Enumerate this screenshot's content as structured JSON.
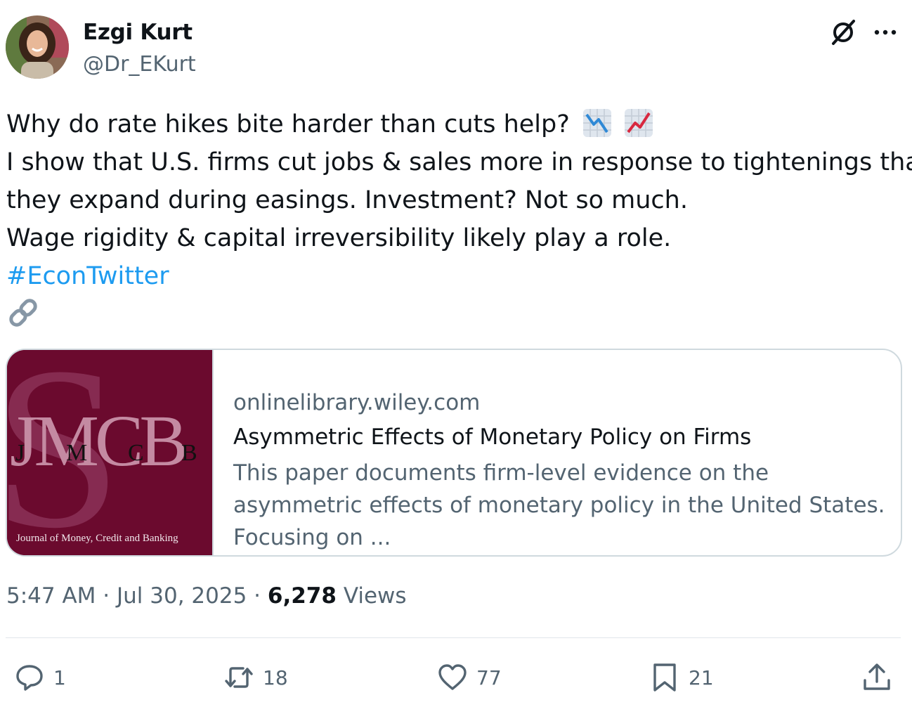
{
  "author": {
    "display_name": "Ezgi Kurt",
    "handle": "@Dr_EKurt"
  },
  "header_icons": [
    "grok-icon",
    "more-icon"
  ],
  "tweet": {
    "line1": "Why do rate hikes bite harder than cuts help?",
    "line2": "I show that U.S. firms cut jobs & sales more in response to tightenings than",
    "line3": "they expand during easings. Investment? Not so much.",
    "line4": "Wage rigidity & capital irreversibility likely play a role.",
    "hashtag": "#EconTwitter",
    "emojis": [
      "chart-decreasing-icon",
      "chart-increasing-icon"
    ]
  },
  "card": {
    "domain": "onlinelibrary.wiley.com",
    "title": "Asymmetric Effects of Monetary Policy on Firms",
    "description": "This paper documents firm-level evidence on the asymmetric effects of monetary policy in the United States. Focusing on ...",
    "thumbnail": {
      "big_letters": "JMCB",
      "letter_j": "J",
      "letter_m": "M",
      "letter_c": "C",
      "letter_b": "B",
      "journal_name": "Journal of Money, Credit and Banking",
      "bg_color": "#6b0a2e"
    }
  },
  "meta": {
    "time": "5:47 AM",
    "separator": "·",
    "date": "Jul 30, 2025",
    "views_count": "6,278",
    "views_label": "Views"
  },
  "actions": {
    "replies": "1",
    "reposts": "18",
    "likes": "77",
    "bookmarks": "21"
  },
  "colors": {
    "link": "#1d9bf0",
    "secondary_text": "#536471",
    "border": "#cfd9de"
  }
}
